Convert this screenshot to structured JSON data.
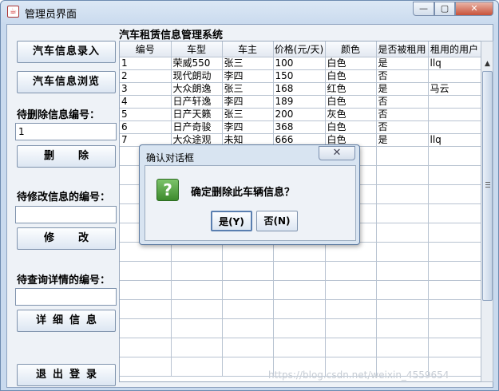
{
  "window": {
    "title": "管理员界面",
    "icon_name": "java-cup-icon",
    "min_glyph": "—",
    "max_glyph": "▢",
    "close_glyph": "✕"
  },
  "sidebar": {
    "add_button": "汽车信息录入",
    "browse_button": "汽车信息浏览",
    "delete_label": "待删除信息编号：",
    "delete_value": "1",
    "delete_button": "删除",
    "modify_label": "待修改信息的编号：",
    "modify_value": "",
    "modify_button": "修改",
    "query_label": "待查询详情的编号：",
    "query_value": "",
    "detail_button": "详细信息",
    "logout_button": "退出登录"
  },
  "main": {
    "title": "汽车租赁信息管理系统",
    "columns": [
      "编号",
      "车型",
      "车主",
      "价格(元/天)",
      "颜色",
      "是否被租用",
      "租用的用户"
    ],
    "rows": [
      [
        "1",
        "荣威550",
        "张三",
        "100",
        "白色",
        "是",
        "llq"
      ],
      [
        "2",
        "现代朗动",
        "李四",
        "150",
        "白色",
        "否",
        ""
      ],
      [
        "3",
        "大众朗逸",
        "张三",
        "168",
        "红色",
        "是",
        "马云"
      ],
      [
        "4",
        "日产轩逸",
        "李四",
        "189",
        "白色",
        "否",
        ""
      ],
      [
        "5",
        "日产天籁",
        "张三",
        "200",
        "灰色",
        "否",
        ""
      ],
      [
        "6",
        "日产奇骏",
        "李四",
        "368",
        "白色",
        "否",
        ""
      ],
      [
        "7",
        "大众途观",
        "未知",
        "666",
        "白色",
        "是",
        "llq"
      ]
    ],
    "empty_row_count": 12
  },
  "dialog": {
    "title": "确认对话框",
    "message": "确定删除此车辆信息？",
    "icon_name": "question-icon",
    "yes_label": "是(Y)",
    "no_label": "否(N)"
  },
  "watermark": "https://blog.csdn.net/weixin_4559654"
}
